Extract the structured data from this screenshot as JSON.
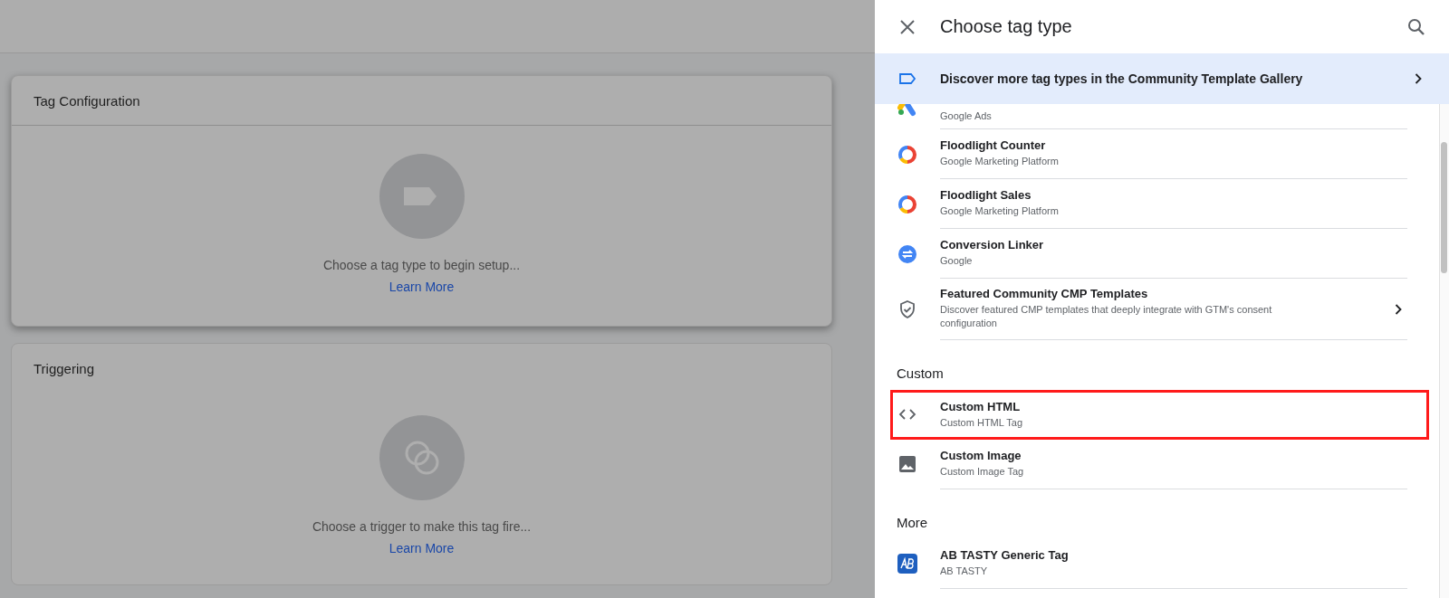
{
  "cards": [
    {
      "title": "Tag Configuration",
      "message": "Choose a tag type to begin setup...",
      "link": "Learn More",
      "kind": "tag"
    },
    {
      "title": "Triggering",
      "message": "Choose a trigger to make this tag fire...",
      "link": "Learn More",
      "kind": "trigger"
    }
  ],
  "panel": {
    "title": "Choose tag type",
    "banner": {
      "text": "Discover more tag types in the Community Template Gallery"
    },
    "entries": [
      {
        "kind": "partial",
        "subtitle": "Google Ads",
        "highlighted": false,
        "has_arrow": false
      },
      {
        "kind": "item",
        "title": "Floodlight Counter",
        "subtitle": "Google Marketing Platform",
        "highlighted": false,
        "has_arrow": false
      },
      {
        "kind": "item",
        "title": "Floodlight Sales",
        "subtitle": "Google Marketing Platform",
        "highlighted": false,
        "has_arrow": false
      },
      {
        "kind": "item",
        "title": "Conversion Linker",
        "subtitle": "Google",
        "highlighted": false,
        "has_arrow": false
      },
      {
        "kind": "item",
        "title": "Featured Community CMP Templates",
        "subtitle": "Discover featured CMP templates that deeply integrate with GTM's consent configuration",
        "highlighted": false,
        "has_arrow": true
      },
      {
        "kind": "section",
        "title": "Custom"
      },
      {
        "kind": "item",
        "title": "Custom HTML",
        "subtitle": "Custom HTML Tag",
        "highlighted": true,
        "has_arrow": false
      },
      {
        "kind": "item",
        "title": "Custom Image",
        "subtitle": "Custom Image Tag",
        "highlighted": false,
        "has_arrow": false
      },
      {
        "kind": "section",
        "title": "More"
      },
      {
        "kind": "item",
        "title": "AB TASTY Generic Tag",
        "subtitle": "AB TASTY",
        "highlighted": false,
        "has_arrow": false
      }
    ]
  }
}
